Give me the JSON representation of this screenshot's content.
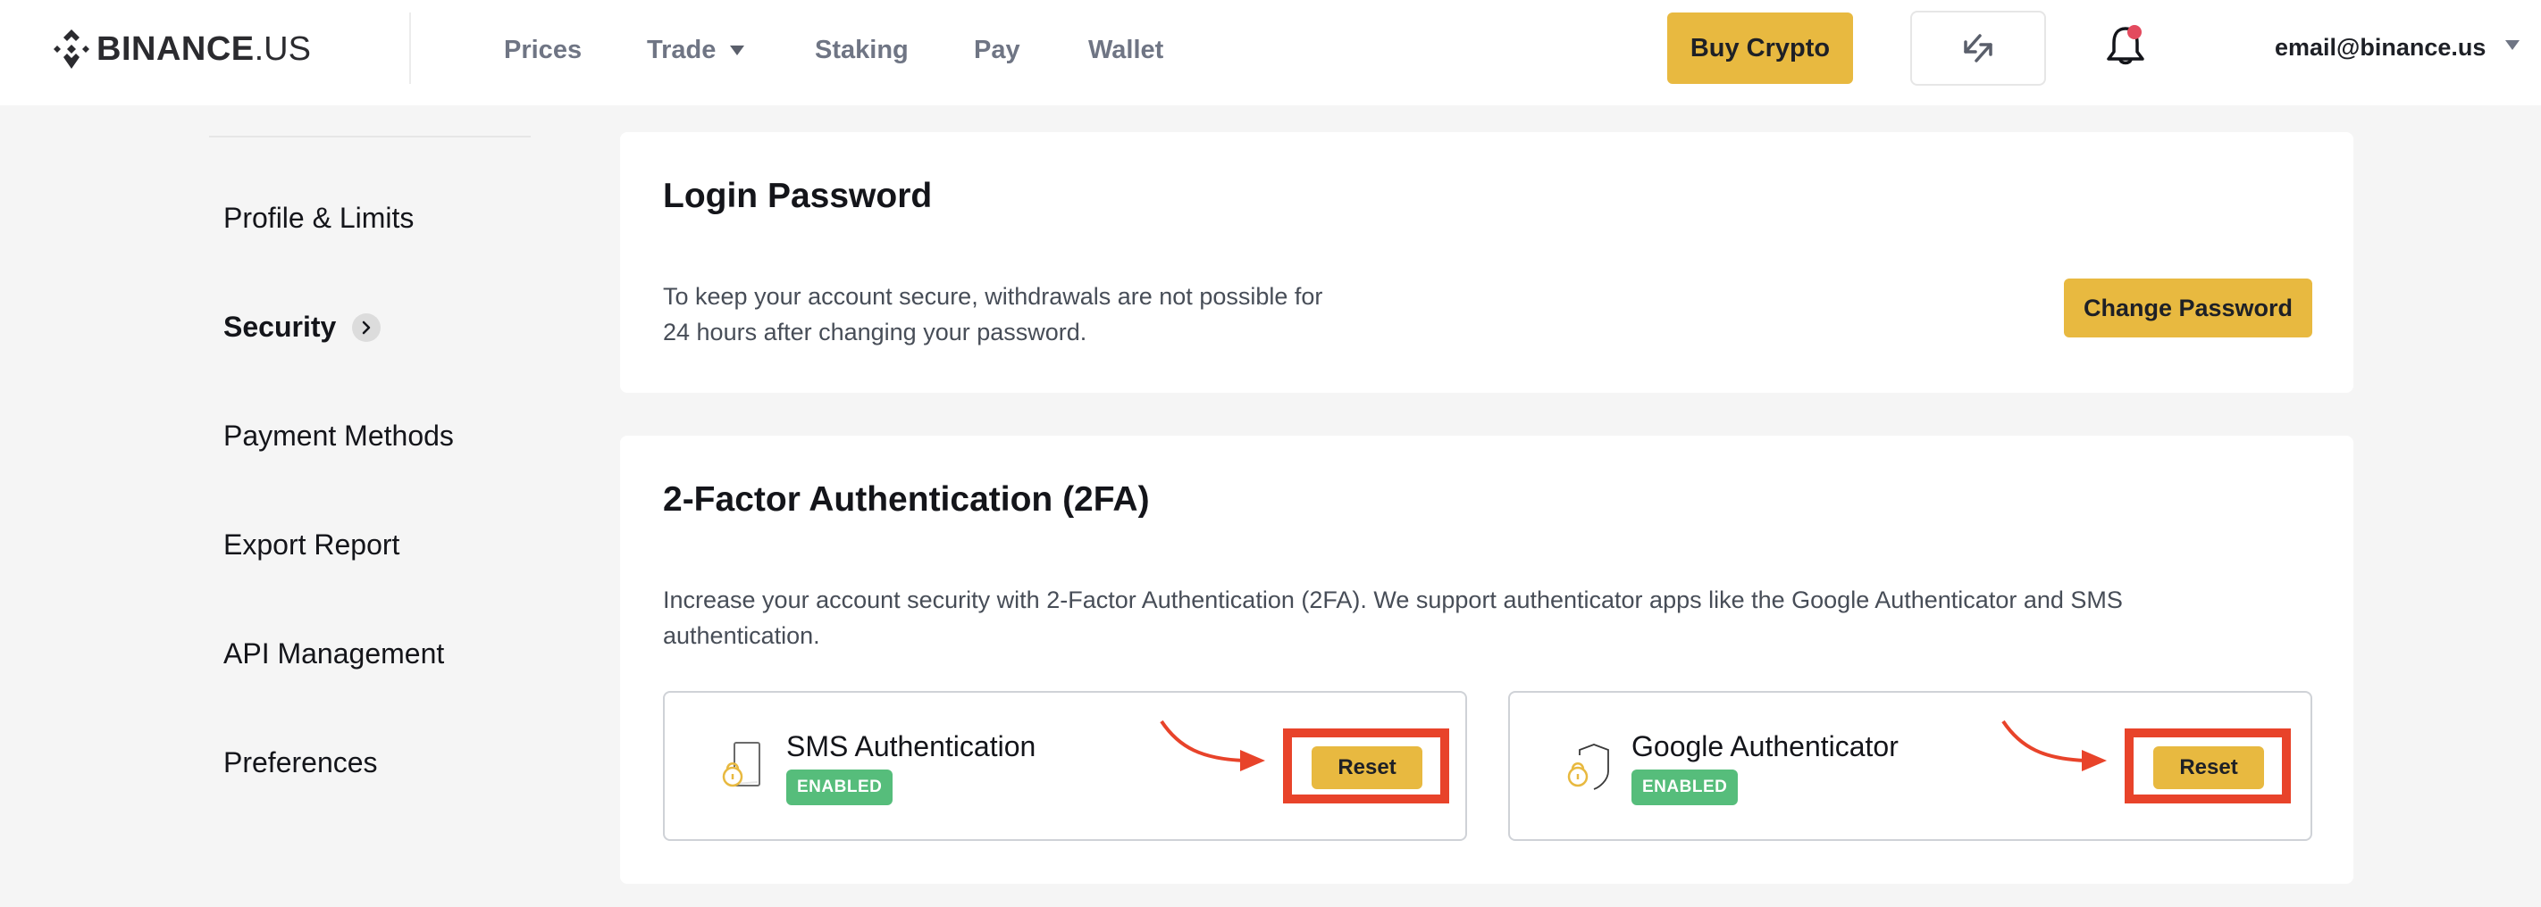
{
  "header": {
    "brand": "BINANCE",
    "brand_suffix": ".US",
    "nav": [
      {
        "label": "Prices"
      },
      {
        "label": "Trade",
        "has_dropdown": true
      },
      {
        "label": "Staking"
      },
      {
        "label": "Pay"
      },
      {
        "label": "Wallet"
      }
    ],
    "buy_crypto_label": "Buy Crypto",
    "convert_icon": "swap-arrows-icon",
    "notification_icon": "bell-icon",
    "has_unread_notifications": true,
    "account_email": "email@binance.us"
  },
  "sidebar": {
    "items": [
      {
        "label": "Profile & Limits",
        "active": false
      },
      {
        "label": "Security",
        "active": true
      },
      {
        "label": "Payment Methods",
        "active": false
      },
      {
        "label": "Export Report",
        "active": false
      },
      {
        "label": "API Management",
        "active": false
      },
      {
        "label": "Preferences",
        "active": false
      }
    ]
  },
  "login_password": {
    "title": "Login Password",
    "description_line1": "To keep your account secure, withdrawals are not possible for",
    "description_line2": "24 hours after changing your password.",
    "button_label": "Change Password"
  },
  "two_factor": {
    "title": "2-Factor Authentication (2FA)",
    "description_line1": "Increase your account security with 2-Factor Authentication (2FA). We support authenticator apps like the Google Authenticator and SMS",
    "description_line2": "authentication.",
    "methods": [
      {
        "name": "SMS Authentication",
        "status": "ENABLED",
        "icon": "phone-lock-icon",
        "action_label": "Reset"
      },
      {
        "name": "Google Authenticator",
        "status": "ENABLED",
        "icon": "shield-lock-icon",
        "action_label": "Reset"
      }
    ]
  },
  "colors": {
    "accent": "#e8b940",
    "enabled_badge": "#56bd7b",
    "annotation": "#e8432a",
    "notification_dot": "#e34a5e",
    "page_background": "#f5f5f5"
  }
}
